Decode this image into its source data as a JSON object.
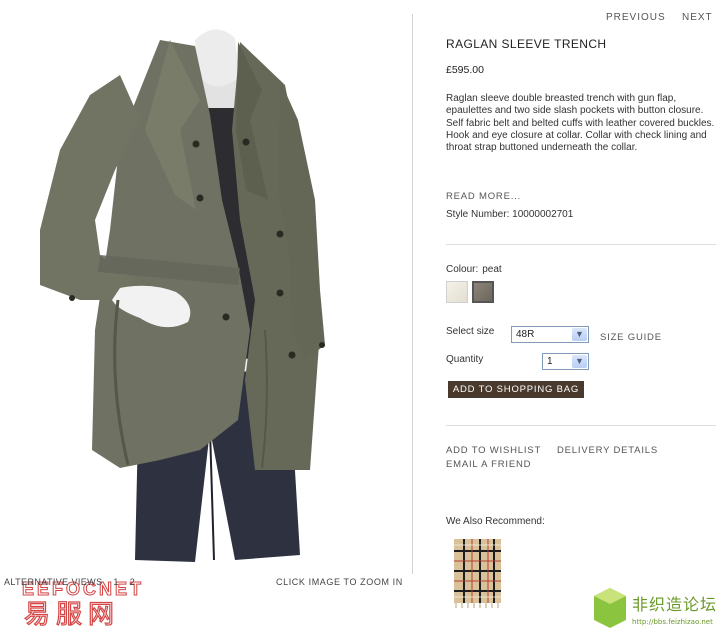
{
  "navigation": {
    "previous": "PREVIOUS",
    "next": "NEXT"
  },
  "product": {
    "title": "RAGLAN SLEEVE TRENCH",
    "price": "£595.00",
    "description": "Raglan sleeve double breasted trench with gun flap, epaulettes and two side slash pockets with button closure. Self fabric belt and belted cuffs with leather covered buckles. Hook and eye closure at collar. Collar with check lining and throat strap buttoned underneath the collar.",
    "read_more": "READ MORE...",
    "style_number": "Style Number: 10000002701",
    "colour_label": "Colour:",
    "colour_value": "peat",
    "swatches": [
      {
        "name": "white",
        "color": "#f0ede4"
      },
      {
        "name": "peat",
        "color": "#7d766c",
        "selected": true
      }
    ],
    "size_label": "Select size",
    "size_selected": "48R",
    "size_guide": "SIZE GUIDE",
    "quantity_label": "Quantity",
    "quantity_selected": "1",
    "add_to_bag": "ADD TO SHOPPING BAG"
  },
  "actions": {
    "wishlist": "ADD TO WISHLIST",
    "delivery": "DELIVERY DETAILS",
    "email_friend": "EMAIL A FRIEND"
  },
  "recommend": {
    "label": "We Also Recommend:"
  },
  "image_area": {
    "alt_views_label": "ALTERNATIVE VIEWS",
    "alt_views": [
      "1",
      "2"
    ],
    "zoom_hint": "CLICK IMAGE TO ZOOM IN"
  },
  "watermarks": {
    "left_brand": "EEFOCNET",
    "left_cn": "易服网",
    "right_cn": "非织造论坛",
    "right_url": "http://bbs.feizhizao.net"
  },
  "colors": {
    "coat": "#6f7162",
    "sweater": "#2c2c31",
    "jeans": "#2e3240",
    "bag_button": "#4a3a2d"
  }
}
